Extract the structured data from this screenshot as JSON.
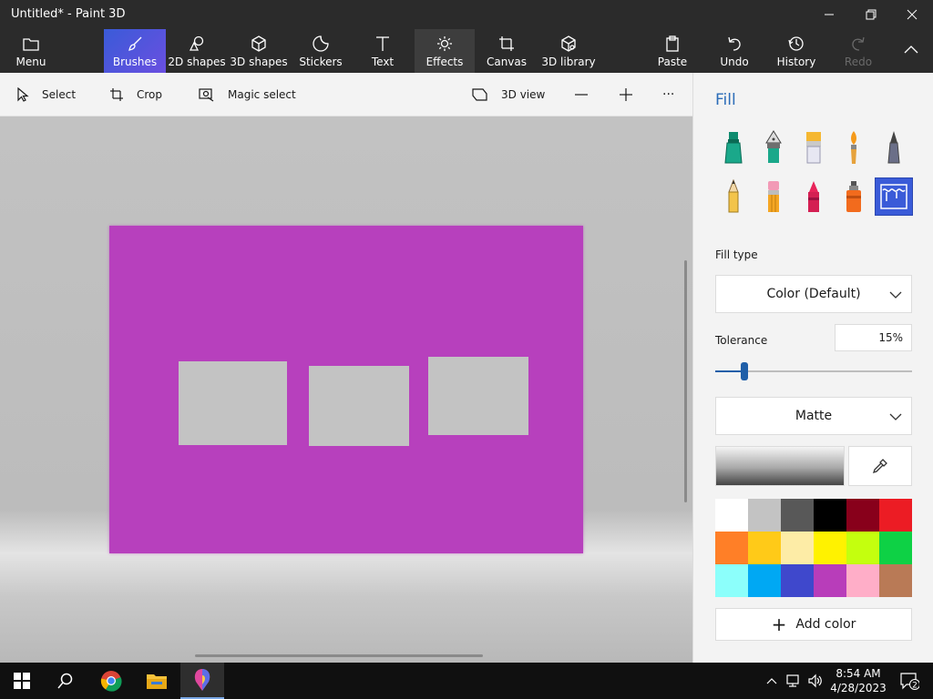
{
  "window": {
    "title": "Untitled* - Paint 3D"
  },
  "ribbon": {
    "menu": "Menu",
    "brushes": "Brushes",
    "shapes2d": "2D shapes",
    "shapes3d": "3D shapes",
    "stickers": "Stickers",
    "text": "Text",
    "effects": "Effects",
    "canvas": "Canvas",
    "library3d": "3D library",
    "paste": "Paste",
    "undo": "Undo",
    "history": "History",
    "redo": "Redo"
  },
  "toolbar": {
    "select": "Select",
    "crop": "Crop",
    "magic_select": "Magic select",
    "view3d": "3D view",
    "more": "···"
  },
  "panel": {
    "title": "Fill",
    "tools": [
      "marker-icon",
      "calligraphy-pen-icon",
      "oil-brush-icon",
      "watercolor-icon",
      "pixel-pen-icon",
      "pencil-icon",
      "eraser-icon",
      "crayon-icon",
      "spray-can-icon",
      "fill-bucket-icon"
    ],
    "selected_tool": "fill-bucket-icon",
    "fill_type_label": "Fill type",
    "fill_type_value": "Color (Default)",
    "tolerance_label": "Tolerance",
    "tolerance_value": "15%",
    "tolerance_fraction": 0.15,
    "finish_value": "Matte",
    "add_color": "Add color",
    "palette": [
      "#ffffff",
      "#c3c3c3",
      "#585858",
      "#000000",
      "#88001b",
      "#ec1c24",
      "#ff7f27",
      "#ffca18",
      "#fdeca6",
      "#fff200",
      "#c4ff0e",
      "#0ed145",
      "#8cfffb",
      "#00a8f3",
      "#3f48cc",
      "#b83dba",
      "#ffaec8",
      "#b97a56"
    ]
  },
  "canvas": {
    "fill_color": "#b740bd",
    "hole_color": "#c3c3c3"
  },
  "taskbar": {
    "time": "8:54 AM",
    "date": "4/28/2023",
    "notifications": "2"
  }
}
